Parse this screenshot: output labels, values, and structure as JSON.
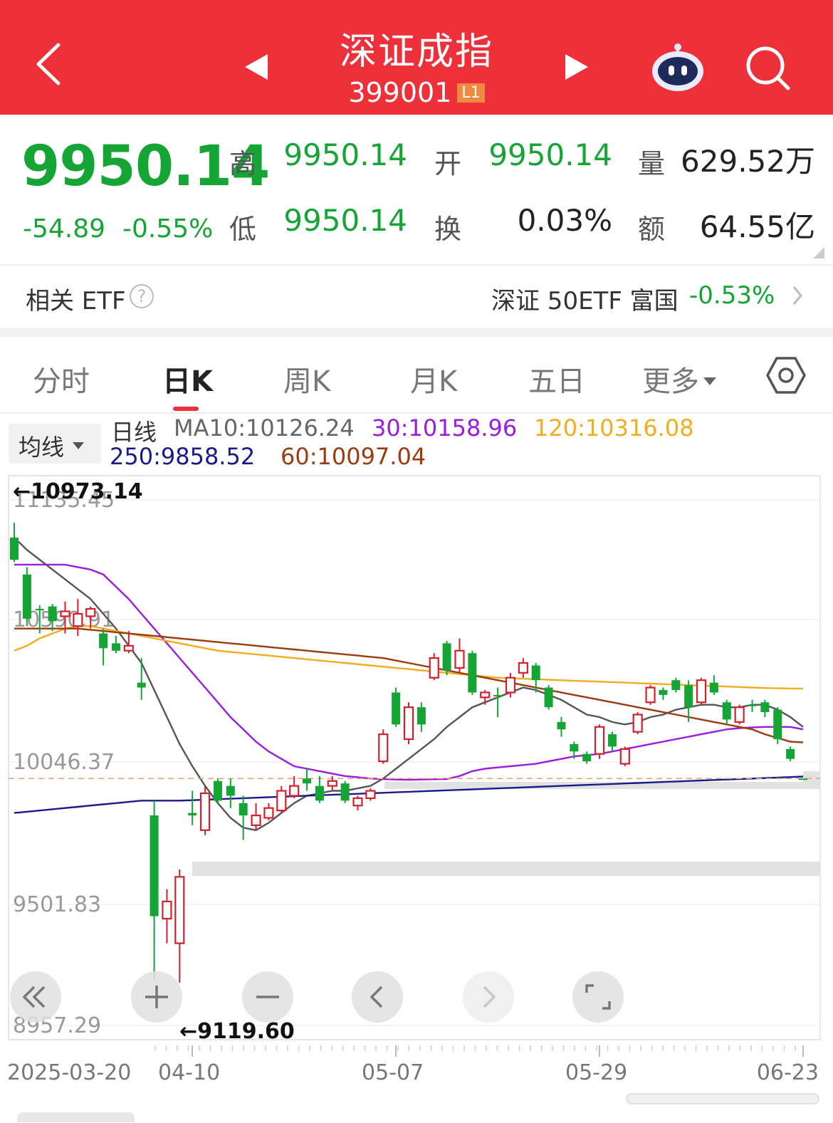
{
  "header": {
    "title": "深证成指",
    "code": "399001",
    "badge": "L1"
  },
  "quote": {
    "price": "9950.14",
    "change": "-54.89",
    "change_pct": "-0.55%",
    "high_label": "高",
    "high": "9950.14",
    "open_label": "开",
    "open": "9950.14",
    "volume_label": "量",
    "volume": "629.52万",
    "low_label": "低",
    "low": "9950.14",
    "turnover_label": "换",
    "turnover": "0.03%",
    "amount_label": "额",
    "amount": "64.55亿"
  },
  "etf": {
    "label": "相关 ETF",
    "help": "?",
    "name": "深证 50ETF 富国",
    "pct": "-0.53%"
  },
  "tabs": [
    "分时",
    "日K",
    "周K",
    "月K",
    "五日",
    "更多"
  ],
  "active_tab": "日K",
  "ma": {
    "selector": "均线",
    "title": "日线",
    "ma10": "MA10:10126.24",
    "ma30": "30:10158.96",
    "ma120": "120:10316.08",
    "ma250": "250:9858.52",
    "ma60": "60:10097.04"
  },
  "colors": {
    "header_bg": "#ee303a",
    "down": "#14a534",
    "up": "#d4202c",
    "ma10": "#555555",
    "ma30": "#9b1be0",
    "ma120": "#f2ad1c",
    "ma250": "#1a1a8c",
    "ma60": "#9a3c10"
  },
  "chart_data": {
    "type": "candlestick",
    "y_axis_labels": [
      "11135.45",
      "10590.91",
      "10046.37",
      "9501.83",
      "8957.29"
    ],
    "ylim": [
      8957.29,
      11135.45
    ],
    "x_axis_labels": [
      "2025-03-20",
      "04-10",
      "05-07",
      "05-29",
      "06-23"
    ],
    "high_marker": "←10973.14",
    "low_marker": "←9119.60",
    "candles": [
      {
        "o": 10930,
        "c": 10840,
        "h": 10990,
        "l": 10830
      },
      {
        "o": 10780,
        "c": 10600,
        "h": 10810,
        "l": 10570
      },
      {
        "o": 10640,
        "c": 10640,
        "h": 10655,
        "l": 10540
      },
      {
        "o": 10650,
        "c": 10590,
        "h": 10660,
        "l": 10550
      },
      {
        "o": 10610,
        "c": 10630,
        "h": 10670,
        "l": 10540
      },
      {
        "o": 10570,
        "c": 10620,
        "h": 10680,
        "l": 10530
      },
      {
        "o": 10610,
        "c": 10640,
        "h": 10650,
        "l": 10560
      },
      {
        "o": 10540,
        "c": 10480,
        "h": 10560,
        "l": 10410
      },
      {
        "o": 10500,
        "c": 10470,
        "h": 10530,
        "l": 10460
      },
      {
        "o": 10470,
        "c": 10490,
        "h": 10550,
        "l": 10460
      },
      {
        "o": 10340,
        "c": 10320,
        "h": 10440,
        "l": 10270
      },
      {
        "o": 9800,
        "c": 9390,
        "h": 9860,
        "l": 9130
      },
      {
        "o": 9380,
        "c": 9450,
        "h": 9500,
        "l": 9280
      },
      {
        "o": 9280,
        "c": 9550,
        "h": 9580,
        "l": 9119.6
      },
      {
        "o": 9810,
        "c": 9800,
        "h": 9900,
        "l": 9760
      },
      {
        "o": 9740,
        "c": 9890,
        "h": 9920,
        "l": 9720
      },
      {
        "o": 9940,
        "c": 9860,
        "h": 9950,
        "l": 9850
      },
      {
        "o": 9920,
        "c": 9880,
        "h": 9950,
        "l": 9830
      },
      {
        "o": 9850,
        "c": 9800,
        "h": 9880,
        "l": 9700
      },
      {
        "o": 9760,
        "c": 9800,
        "h": 9850,
        "l": 9740
      },
      {
        "o": 9790,
        "c": 9830,
        "h": 9850,
        "l": 9780
      },
      {
        "o": 9820,
        "c": 9900,
        "h": 9920,
        "l": 9810
      },
      {
        "o": 9880,
        "c": 9920,
        "h": 9960,
        "l": 9870
      },
      {
        "o": 9950,
        "c": 9930,
        "h": 9990,
        "l": 9900
      },
      {
        "o": 9920,
        "c": 9860,
        "h": 9960,
        "l": 9850
      },
      {
        "o": 9920,
        "c": 9940,
        "h": 9960,
        "l": 9900
      },
      {
        "o": 9930,
        "c": 9860,
        "h": 9940,
        "l": 9850
      },
      {
        "o": 9840,
        "c": 9870,
        "h": 9880,
        "l": 9820
      },
      {
        "o": 9870,
        "c": 9900,
        "h": 9910,
        "l": 9860
      },
      {
        "o": 10020,
        "c": 10130,
        "h": 10150,
        "l": 10010
      },
      {
        "o": 10300,
        "c": 10170,
        "h": 10320,
        "l": 10160
      },
      {
        "o": 10110,
        "c": 10240,
        "h": 10260,
        "l": 10090
      },
      {
        "o": 10240,
        "c": 10170,
        "h": 10260,
        "l": 10140
      },
      {
        "o": 10360,
        "c": 10440,
        "h": 10460,
        "l": 10350
      },
      {
        "o": 10500,
        "c": 10390,
        "h": 10510,
        "l": 10370
      },
      {
        "o": 10400,
        "c": 10470,
        "h": 10520,
        "l": 10380
      },
      {
        "o": 10460,
        "c": 10300,
        "h": 10470,
        "l": 10290
      },
      {
        "o": 10280,
        "c": 10300,
        "h": 10310,
        "l": 10250
      },
      {
        "o": 10290,
        "c": 10290,
        "h": 10320,
        "l": 10200
      },
      {
        "o": 10300,
        "c": 10360,
        "h": 10380,
        "l": 10280
      },
      {
        "o": 10380,
        "c": 10420,
        "h": 10440,
        "l": 10360
      },
      {
        "o": 10410,
        "c": 10350,
        "h": 10420,
        "l": 10300
      },
      {
        "o": 10320,
        "c": 10240,
        "h": 10330,
        "l": 10230
      },
      {
        "o": 10180,
        "c": 10150,
        "h": 10200,
        "l": 10120
      },
      {
        "o": 10090,
        "c": 10060,
        "h": 10100,
        "l": 10030
      },
      {
        "o": 10050,
        "c": 10020,
        "h": 10060,
        "l": 10010
      },
      {
        "o": 10050,
        "c": 10160,
        "h": 10170,
        "l": 10030
      },
      {
        "o": 10130,
        "c": 10080,
        "h": 10140,
        "l": 10060
      },
      {
        "o": 10010,
        "c": 10070,
        "h": 10080,
        "l": 10000
      },
      {
        "o": 10140,
        "c": 10210,
        "h": 10220,
        "l": 10130
      },
      {
        "o": 10260,
        "c": 10320,
        "h": 10330,
        "l": 10250
      },
      {
        "o": 10310,
        "c": 10290,
        "h": 10320,
        "l": 10270
      },
      {
        "o": 10350,
        "c": 10310,
        "h": 10360,
        "l": 10300
      },
      {
        "o": 10330,
        "c": 10240,
        "h": 10350,
        "l": 10180
      },
      {
        "o": 10260,
        "c": 10350,
        "h": 10360,
        "l": 10250
      },
      {
        "o": 10340,
        "c": 10300,
        "h": 10370,
        "l": 10290
      },
      {
        "o": 10260,
        "c": 10190,
        "h": 10270,
        "l": 10170
      },
      {
        "o": 10180,
        "c": 10240,
        "h": 10250,
        "l": 10170
      },
      {
        "o": 10250,
        "c": 10250,
        "h": 10270,
        "l": 10220
      },
      {
        "o": 10260,
        "c": 10220,
        "h": 10270,
        "l": 10200
      },
      {
        "o": 10230,
        "c": 10110,
        "h": 10240,
        "l": 10090
      },
      {
        "o": 10070,
        "c": 10030,
        "h": 10080,
        "l": 10020
      },
      {
        "o": 9950.14,
        "c": 9950.14,
        "h": 9950.14,
        "l": 9950.14
      }
    ],
    "series": [
      {
        "name": "MA10",
        "values": [
          10930,
          10880,
          10840,
          10800,
          10760,
          10720,
          10680,
          10620,
          10560,
          10490,
          10420,
          10310,
          10200,
          10090,
          10000,
          9920,
          9850,
          9790,
          9750,
          9740,
          9770,
          9810,
          9850,
          9880,
          9890,
          9900,
          9900,
          9910,
          9920,
          9950,
          9990,
          10030,
          10070,
          10110,
          10160,
          10200,
          10240,
          10260,
          10280,
          10300,
          10320,
          10310,
          10290,
          10270,
          10240,
          10210,
          10200,
          10180,
          10170,
          10180,
          10200,
          10210,
          10230,
          10240,
          10250,
          10250,
          10240,
          10240,
          10250,
          10250,
          10230,
          10200,
          10160
        ]
      },
      {
        "name": "30",
        "values": [
          10820,
          10820,
          10820,
          10820,
          10820,
          10810,
          10800,
          10780,
          10730,
          10680,
          10620,
          10560,
          10500,
          10440,
          10380,
          10320,
          10260,
          10200,
          10150,
          10100,
          10060,
          10030,
          10000,
          9990,
          9980,
          9970,
          9960,
          9955,
          9950,
          9948,
          9946,
          9945,
          9946,
          9947,
          9948,
          9960,
          9980,
          9990,
          9995,
          10000,
          10005,
          10010,
          10020,
          10030,
          10040,
          10045,
          10050,
          10060,
          10070,
          10080,
          10090,
          10100,
          10110,
          10120,
          10130,
          10140,
          10150,
          10155,
          10158,
          10160,
          10160,
          10160,
          10150
        ]
      },
      {
        "name": "120",
        "values": [
          10470,
          10490,
          10520,
          10540,
          10560,
          10570,
          10570,
          10560,
          10550,
          10540,
          10530,
          10520,
          10510,
          10500,
          10490,
          10480,
          10470,
          10465,
          10460,
          10455,
          10450,
          10445,
          10440,
          10435,
          10430,
          10425,
          10420,
          10415,
          10410,
          10405,
          10400,
          10395,
          10390,
          10385,
          10380,
          10375,
          10370,
          10365,
          10360,
          10358,
          10356,
          10354,
          10352,
          10350,
          10348,
          10346,
          10344,
          10342,
          10340,
          10338,
          10336,
          10334,
          10332,
          10330,
          10328,
          10326,
          10324,
          10322,
          10320,
          10318,
          10317,
          10316,
          10316
        ]
      },
      {
        "name": "250",
        "values": [
          9810,
          9815,
          9820,
          9825,
          9830,
          9835,
          9840,
          9845,
          9850,
          9855,
          9860,
          9860,
          9860,
          9860,
          9862,
          9864,
          9866,
          9868,
          9870,
          9872,
          9874,
          9876,
          9878,
          9880,
          9882,
          9884,
          9886,
          9888,
          9890,
          9892,
          9894,
          9896,
          9898,
          9900,
          9902,
          9904,
          9906,
          9908,
          9910,
          9912,
          9914,
          9916,
          9918,
          9920,
          9922,
          9924,
          9926,
          9928,
          9930,
          9932,
          9934,
          9936,
          9938,
          9940,
          9942,
          9944,
          9946,
          9948,
          9950,
          9952,
          9954,
          9956,
          9958
        ]
      },
      {
        "name": "60",
        "values": [
          10560,
          10560,
          10560,
          10560,
          10560,
          10560,
          10555,
          10550,
          10545,
          10540,
          10535,
          10530,
          10525,
          10520,
          10515,
          10510,
          10505,
          10500,
          10495,
          10490,
          10485,
          10480,
          10475,
          10470,
          10465,
          10460,
          10455,
          10450,
          10445,
          10440,
          10430,
          10420,
          10410,
          10400,
          10390,
          10380,
          10370,
          10360,
          10350,
          10340,
          10330,
          10320,
          10310,
          10300,
          10290,
          10280,
          10270,
          10260,
          10250,
          10240,
          10230,
          10220,
          10210,
          10200,
          10190,
          10180,
          10170,
          10160,
          10150,
          10130,
          10115,
          10100,
          10097
        ]
      }
    ],
    "current_price_line": 9950.14
  }
}
